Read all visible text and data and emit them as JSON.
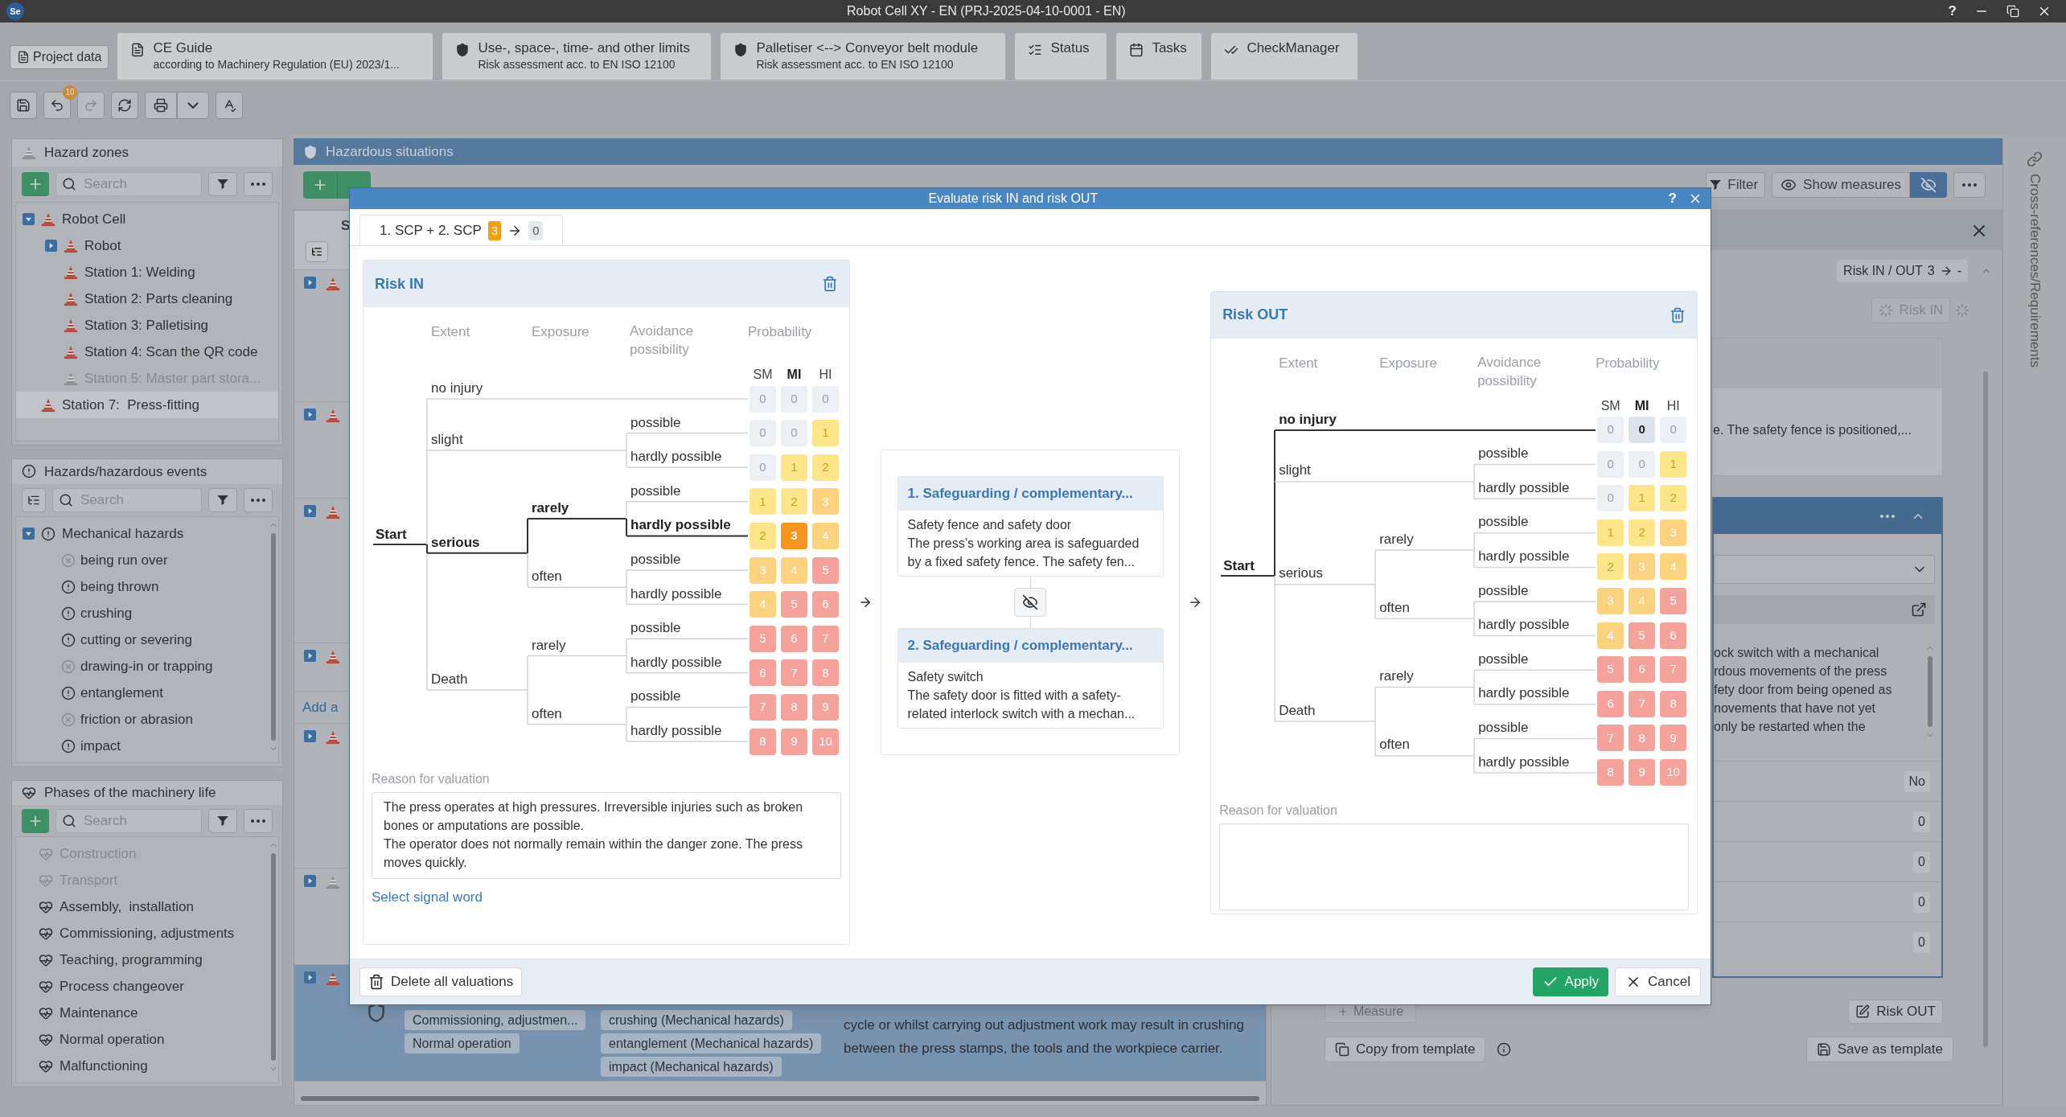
{
  "window": {
    "logo": "Se",
    "title": "Robot Cell XY - EN (PRJ-2025-04-10-0001 - EN)",
    "help": "?"
  },
  "tabs": [
    {
      "kind": "button",
      "label": "Project data"
    },
    {
      "kind": "guide",
      "label": "CE Guide",
      "sublabel": "according to Machinery Regulation (EU) 2023/1..."
    },
    {
      "kind": "shield",
      "label": "Use-, space-, time- and other limits",
      "sublabel": "Risk assessment acc. to EN ISO 12100"
    },
    {
      "kind": "shield",
      "label": "Palletiser <--> Conveyor belt module",
      "sublabel": "Risk assessment acc. to EN ISO 12100"
    },
    {
      "kind": "status",
      "label": "Status"
    },
    {
      "kind": "tasks",
      "label": "Tasks"
    },
    {
      "kind": "check",
      "label": "CheckManager"
    }
  ],
  "toolbar": {
    "undo_count": "10"
  },
  "hazard_zones": {
    "title": "Hazard zones",
    "search_placeholder": "Search",
    "items": [
      {
        "label": "Robot Cell",
        "kind": "group",
        "expanded": true,
        "selected": false,
        "disabled": false,
        "children": [
          {
            "label": "Robot",
            "kind": "group",
            "expanded": false,
            "selected": false,
            "disabled": false
          },
          {
            "label": "Station 1: Welding",
            "kind": "leaf",
            "selected": false,
            "disabled": false
          },
          {
            "label": "Station 2: Parts cleaning",
            "kind": "leaf",
            "selected": false,
            "disabled": false
          },
          {
            "label": "Station 3: Palletising",
            "kind": "leaf",
            "selected": false,
            "disabled": false
          },
          {
            "label": "Station 4: Scan the QR code",
            "kind": "leaf",
            "selected": false,
            "disabled": false
          },
          {
            "label": "Station 5: Master part stora...",
            "kind": "leaf",
            "selected": false,
            "disabled": true
          }
        ]
      },
      {
        "label": "Station 7:  Press-fitting",
        "kind": "leaf",
        "selected": true,
        "disabled": false
      }
    ]
  },
  "hazards": {
    "title": "Hazards/hazardous events",
    "search_placeholder": "Search",
    "group": {
      "label": "Mechanical hazards",
      "expanded": true
    },
    "items": [
      {
        "label": "being run over",
        "excluded": true
      },
      {
        "label": "being thrown",
        "excluded": false
      },
      {
        "label": "crushing",
        "excluded": false
      },
      {
        "label": "cutting or severing",
        "excluded": false
      },
      {
        "label": "drawing-in or trapping",
        "excluded": true
      },
      {
        "label": "entanglement",
        "excluded": false
      },
      {
        "label": "friction or abrasion",
        "excluded": true
      },
      {
        "label": "impact",
        "excluded": false
      }
    ]
  },
  "phases": {
    "title": "Phases of the machinery life",
    "search_placeholder": "Search",
    "items": [
      {
        "label": "Construction",
        "disabled": true
      },
      {
        "label": "Transport",
        "disabled": true
      },
      {
        "label": "Assembly,  installation",
        "disabled": false
      },
      {
        "label": "Commissioning, adjustments",
        "disabled": false
      },
      {
        "label": "Teaching, programming",
        "disabled": false
      },
      {
        "label": "Process changeover",
        "disabled": false
      },
      {
        "label": "Maintenance",
        "disabled": false
      },
      {
        "label": "Normal operation",
        "disabled": false
      },
      {
        "label": "Malfunctioning",
        "disabled": false
      }
    ]
  },
  "situations": {
    "title": "Hazardous situations",
    "column_1": "S",
    "add_link": "Add a",
    "rows": [
      {
        "disabled": false,
        "selected": false
      },
      {
        "disabled": false,
        "selected": false
      },
      {
        "disabled": false,
        "selected": false
      },
      {
        "disabled": false,
        "selected": false
      },
      {
        "disabled": false,
        "selected": false
      },
      {
        "disabled": true,
        "selected": false
      },
      {
        "disabled": false,
        "selected": true
      }
    ],
    "selected_row": {
      "phases": [
        "Commissioning, adjustmen...",
        "Normal operation"
      ],
      "hazards": [
        "crushing (Mechanical hazards)",
        "entanglement (Mechanical hazards)",
        "impact (Mechanical hazards)"
      ],
      "description": "cycle or whilst carrying out adjustment work may result in crushing between the press stamps, the tools and the workpiece carrier."
    }
  },
  "details": {
    "filter": "Filter",
    "show_measures": "Show measures",
    "risk_badge": {
      "label": "Risk IN / OUT",
      "risk_in": "3",
      "risk_out": "-"
    },
    "risk_in_button": "Risk IN",
    "card_text": "e. The safety fence is positioned,...",
    "measure_lines": [
      "ock switch with a mechanical",
      "rdous movements of the press",
      "fety door from being opened as",
      "novements that have not yet",
      "only be restarted when the"
    ],
    "values": [
      "No",
      "0",
      "0",
      "0",
      "0"
    ],
    "risk_out_button": "Risk OUT",
    "measure_button": "Measure",
    "copy_template": "Copy from template",
    "save_template": "Save as template"
  },
  "side_strip": {
    "label": "Cross-references/Requirements"
  },
  "dialog": {
    "title": "Evaluate risk IN and risk OUT",
    "help": "?",
    "tab": {
      "label": "1. SCP + 2. SCP",
      "risk_in": "3",
      "risk_out": "0",
      "selected": true
    },
    "risk_in": {
      "title": "Risk IN",
      "headers": {
        "extent": "Extent",
        "exposure": "Exposure",
        "avoidance": "Avoidance possibility",
        "probability": "Probability"
      },
      "prob_columns": [
        {
          "label": "SM",
          "selected": false
        },
        {
          "label": "MI",
          "selected": true
        },
        {
          "label": "HI",
          "selected": false
        }
      ],
      "start": "Start",
      "tree": [
        {
          "kind": "extent",
          "label": "no injury",
          "selected": false,
          "cells": [
            {
              "value": "0",
              "color": "#eceff3",
              "selected": false
            },
            {
              "value": "0",
              "color": "#eceff3",
              "selected": false
            },
            {
              "value": "0",
              "color": "#eceff3",
              "selected": false
            }
          ]
        },
        {
          "kind": "extent",
          "label": "slight",
          "selected": false,
          "children": [
            {
              "kind": "avoidance",
              "label": "possible",
              "selected": false,
              "cells": [
                {
                  "value": "0",
                  "color": "#eceff3",
                  "selected": false
                },
                {
                  "value": "0",
                  "color": "#eceff3",
                  "selected": false
                },
                {
                  "value": "1",
                  "color": "#fde68a",
                  "selected": false
                }
              ]
            },
            {
              "kind": "avoidance",
              "label": "hardly possible",
              "selected": false,
              "cells": [
                {
                  "value": "0",
                  "color": "#eceff3",
                  "selected": false
                },
                {
                  "value": "1",
                  "color": "#fde68a",
                  "selected": false
                },
                {
                  "value": "2",
                  "color": "#fde68a",
                  "selected": false
                }
              ]
            }
          ]
        },
        {
          "kind": "extent",
          "label": "serious",
          "selected": true,
          "children": [
            {
              "kind": "exposure",
              "label": "rarely",
              "selected": true,
              "children": [
                {
                  "kind": "avoidance",
                  "label": "possible",
                  "selected": false,
                  "cells": [
                    {
                      "value": "1",
                      "color": "#fde68a",
                      "selected": false
                    },
                    {
                      "value": "2",
                      "color": "#fde68a",
                      "selected": false
                    },
                    {
                      "value": "3",
                      "color": "#fcd27e",
                      "selected": false
                    }
                  ]
                },
                {
                  "kind": "avoidance",
                  "label": "hardly possible",
                  "selected": true,
                  "cells": [
                    {
                      "value": "2",
                      "color": "#fde68a",
                      "selected": false
                    },
                    {
                      "value": "3",
                      "color": "#f7941d",
                      "selected": true
                    },
                    {
                      "value": "4",
                      "color": "#fcd27e",
                      "selected": false
                    }
                  ]
                }
              ]
            },
            {
              "kind": "exposure",
              "label": "often",
              "selected": false,
              "children": [
                {
                  "kind": "avoidance",
                  "label": "possible",
                  "selected": false,
                  "cells": [
                    {
                      "value": "3",
                      "color": "#fcd27e",
                      "selected": false
                    },
                    {
                      "value": "4",
                      "color": "#fcd27e",
                      "selected": false
                    },
                    {
                      "value": "5",
                      "color": "#f5a39a",
                      "selected": false
                    }
                  ]
                },
                {
                  "kind": "avoidance",
                  "label": "hardly possible",
                  "selected": false,
                  "cells": [
                    {
                      "value": "4",
                      "color": "#fcd27e",
                      "selected": false
                    },
                    {
                      "value": "5",
                      "color": "#f5a39a",
                      "selected": false
                    },
                    {
                      "value": "6",
                      "color": "#f5a39a",
                      "selected": false
                    }
                  ]
                }
              ]
            }
          ]
        },
        {
          "kind": "extent",
          "label": "Death",
          "selected": false,
          "children": [
            {
              "kind": "exposure",
              "label": "rarely",
              "selected": false,
              "children": [
                {
                  "kind": "avoidance",
                  "label": "possible",
                  "selected": false,
                  "cells": [
                    {
                      "value": "5",
                      "color": "#f5a39a",
                      "selected": false
                    },
                    {
                      "value": "6",
                      "color": "#f5a39a",
                      "selected": false
                    },
                    {
                      "value": "7",
                      "color": "#f5a39a",
                      "selected": false
                    }
                  ]
                },
                {
                  "kind": "avoidance",
                  "label": "hardly possible",
                  "selected": false,
                  "cells": [
                    {
                      "value": "6",
                      "color": "#f5a39a",
                      "selected": false
                    },
                    {
                      "value": "7",
                      "color": "#f5a39a",
                      "selected": false
                    },
                    {
                      "value": "8",
                      "color": "#f5a39a",
                      "selected": false
                    }
                  ]
                }
              ]
            },
            {
              "kind": "exposure",
              "label": "often",
              "selected": false,
              "children": [
                {
                  "kind": "avoidance",
                  "label": "possible",
                  "selected": false,
                  "cells": [
                    {
                      "value": "7",
                      "color": "#f5a39a",
                      "selected": false
                    },
                    {
                      "value": "8",
                      "color": "#f5a39a",
                      "selected": false
                    },
                    {
                      "value": "9",
                      "color": "#f5a39a",
                      "selected": false
                    }
                  ]
                },
                {
                  "kind": "avoidance",
                  "label": "hardly possible",
                  "selected": false,
                  "cells": [
                    {
                      "value": "8",
                      "color": "#f5a39a",
                      "selected": false
                    },
                    {
                      "value": "9",
                      "color": "#f5a39a",
                      "selected": false
                    },
                    {
                      "value": "10",
                      "color": "#f5a39a",
                      "selected": false
                    }
                  ]
                }
              ]
            }
          ]
        }
      ],
      "reason_label": "Reason for valuation",
      "reason": "The press operates at high pressures. Irreversible injuries such as broken bones or amputations are possible.\nThe operator does not normally remain within the danger zone. The press moves quickly.",
      "signal_word": "Select signal word"
    },
    "measures": [
      {
        "title": "1. Safeguarding / complementary...",
        "name": "Safety fence and safety door",
        "description": "The press’s working area is safeguarded by a fixed safety fence. The safety fen..."
      },
      {
        "title": "2. Safeguarding / complementary...",
        "name": "Safety switch",
        "description": "The safety door is fitted with a safety-related interlock switch with a mechan..."
      }
    ],
    "risk_out": {
      "title": "Risk OUT",
      "headers": {
        "extent": "Extent",
        "exposure": "Exposure",
        "avoidance": "Avoidance possibility",
        "probability": "Probability"
      },
      "prob_columns": [
        {
          "label": "SM",
          "selected": false
        },
        {
          "label": "MI",
          "selected": true
        },
        {
          "label": "HI",
          "selected": false
        }
      ],
      "start": "Start",
      "tree": [
        {
          "kind": "extent",
          "label": "no injury",
          "selected": true,
          "cells": [
            {
              "value": "0",
              "color": "#eceff3",
              "selected": false
            },
            {
              "value": "0",
              "color": "#dde3ea",
              "selected": true
            },
            {
              "value": "0",
              "color": "#eceff3",
              "selected": false
            }
          ]
        },
        {
          "kind": "extent",
          "label": "slight",
          "selected": false,
          "children": [
            {
              "kind": "avoidance",
              "label": "possible",
              "selected": false,
              "cells": [
                {
                  "value": "0",
                  "color": "#eceff3",
                  "selected": false
                },
                {
                  "value": "0",
                  "color": "#eceff3",
                  "selected": false
                },
                {
                  "value": "1",
                  "color": "#fde68a",
                  "selected": false
                }
              ]
            },
            {
              "kind": "avoidance",
              "label": "hardly possible",
              "selected": false,
              "cells": [
                {
                  "value": "0",
                  "color": "#eceff3",
                  "selected": false
                },
                {
                  "value": "1",
                  "color": "#fde68a",
                  "selected": false
                },
                {
                  "value": "2",
                  "color": "#fde68a",
                  "selected": false
                }
              ]
            }
          ]
        },
        {
          "kind": "extent",
          "label": "serious",
          "selected": false,
          "children": [
            {
              "kind": "exposure",
              "label": "rarely",
              "selected": false,
              "children": [
                {
                  "kind": "avoidance",
                  "label": "possible",
                  "selected": false,
                  "cells": [
                    {
                      "value": "1",
                      "color": "#fde68a",
                      "selected": false
                    },
                    {
                      "value": "2",
                      "color": "#fde68a",
                      "selected": false
                    },
                    {
                      "value": "3",
                      "color": "#fcd27e",
                      "selected": false
                    }
                  ]
                },
                {
                  "kind": "avoidance",
                  "label": "hardly possible",
                  "selected": false,
                  "cells": [
                    {
                      "value": "2",
                      "color": "#fde68a",
                      "selected": false
                    },
                    {
                      "value": "3",
                      "color": "#fcd27e",
                      "selected": false
                    },
                    {
                      "value": "4",
                      "color": "#fcd27e",
                      "selected": false
                    }
                  ]
                }
              ]
            },
            {
              "kind": "exposure",
              "label": "often",
              "selected": false,
              "children": [
                {
                  "kind": "avoidance",
                  "label": "possible",
                  "selected": false,
                  "cells": [
                    {
                      "value": "3",
                      "color": "#fcd27e",
                      "selected": false
                    },
                    {
                      "value": "4",
                      "color": "#fcd27e",
                      "selected": false
                    },
                    {
                      "value": "5",
                      "color": "#f5a39a",
                      "selected": false
                    }
                  ]
                },
                {
                  "kind": "avoidance",
                  "label": "hardly possible",
                  "selected": false,
                  "cells": [
                    {
                      "value": "4",
                      "color": "#fcd27e",
                      "selected": false
                    },
                    {
                      "value": "5",
                      "color": "#f5a39a",
                      "selected": false
                    },
                    {
                      "value": "6",
                      "color": "#f5a39a",
                      "selected": false
                    }
                  ]
                }
              ]
            }
          ]
        },
        {
          "kind": "extent",
          "label": "Death",
          "selected": false,
          "children": [
            {
              "kind": "exposure",
              "label": "rarely",
              "selected": false,
              "children": [
                {
                  "kind": "avoidance",
                  "label": "possible",
                  "selected": false,
                  "cells": [
                    {
                      "value": "5",
                      "color": "#f5a39a",
                      "selected": false
                    },
                    {
                      "value": "6",
                      "color": "#f5a39a",
                      "selected": false
                    },
                    {
                      "value": "7",
                      "color": "#f5a39a",
                      "selected": false
                    }
                  ]
                },
                {
                  "kind": "avoidance",
                  "label": "hardly possible",
                  "selected": false,
                  "cells": [
                    {
                      "value": "6",
                      "color": "#f5a39a",
                      "selected": false
                    },
                    {
                      "value": "7",
                      "color": "#f5a39a",
                      "selected": false
                    },
                    {
                      "value": "8",
                      "color": "#f5a39a",
                      "selected": false
                    }
                  ]
                }
              ]
            },
            {
              "kind": "exposure",
              "label": "often",
              "selected": false,
              "children": [
                {
                  "kind": "avoidance",
                  "label": "possible",
                  "selected": false,
                  "cells": [
                    {
                      "value": "7",
                      "color": "#f5a39a",
                      "selected": false
                    },
                    {
                      "value": "8",
                      "color": "#f5a39a",
                      "selected": false
                    },
                    {
                      "value": "9",
                      "color": "#f5a39a",
                      "selected": false
                    }
                  ]
                },
                {
                  "kind": "avoidance",
                  "label": "hardly possible",
                  "selected": false,
                  "cells": [
                    {
                      "value": "8",
                      "color": "#f5a39a",
                      "selected": false
                    },
                    {
                      "value": "9",
                      "color": "#f5a39a",
                      "selected": false
                    },
                    {
                      "value": "10",
                      "color": "#f5a39a",
                      "selected": false
                    }
                  ]
                }
              ]
            }
          ]
        }
      ],
      "reason_label": "Reason for valuation"
    },
    "delete_all": "Delete all valuations",
    "apply": "Apply",
    "cancel": "Cancel"
  }
}
